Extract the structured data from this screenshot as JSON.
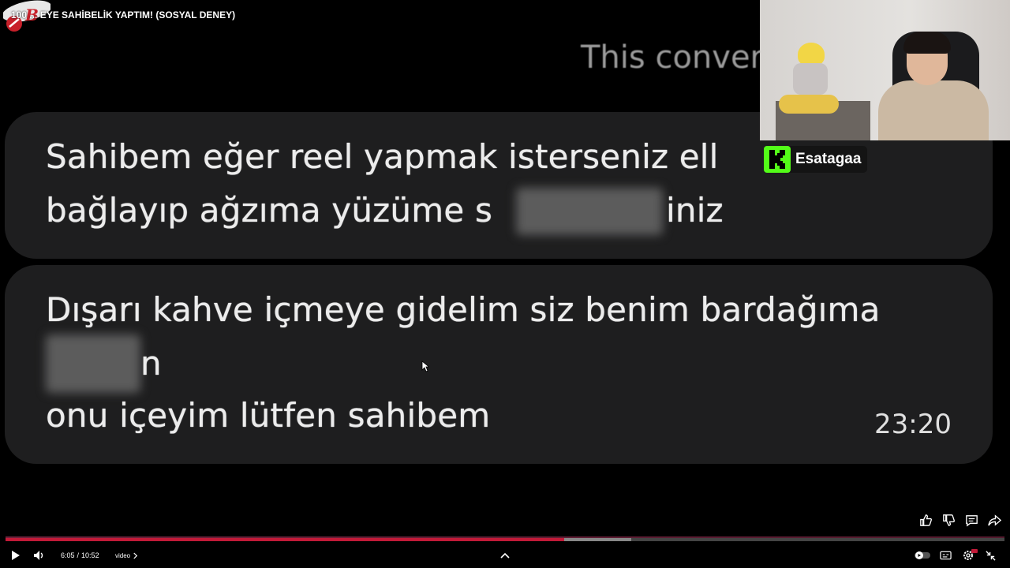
{
  "player": {
    "video_title": "100 ... EYE SAHİBELİK YAPTIM! (SOSYAL DENEY)",
    "header_partial": "This conver",
    "streamer_name": "Esatagaa",
    "time_current": "6:05",
    "time_separator": "/",
    "time_total": "10:52",
    "chapter_label": "video",
    "progress_fraction": 0.559,
    "buffered_fraction": 0.626
  },
  "messages": [
    {
      "line1": "Sahibem eğer reel yapmak isterseniz ell",
      "line2_start": "bağlayıp ağzıma yüzüme s",
      "line2_end": "iniz"
    },
    {
      "line1": "Dışarı kahve içmeye gidelim siz benim bardağıma",
      "line2_end": "n",
      "line3": "onu içeyim lütfen sahibem",
      "time": "23:20"
    }
  ],
  "icons": {
    "like": "thumbs-up-icon",
    "dislike": "thumbs-down-icon",
    "comment": "comment-icon",
    "share": "share-icon",
    "play": "play-icon",
    "volume": "volume-icon",
    "chevron": "chevron-right-icon",
    "expand": "chevron-up-icon",
    "autoplay": "autoplay-toggle-icon",
    "captions": "captions-icon",
    "settings": "settings-icon",
    "fullscreen_exit": "exit-fullscreen-icon"
  },
  "colors": {
    "accent": "#c21a38",
    "bubble": "#1e1e1f",
    "kick_green": "#53fc18"
  }
}
